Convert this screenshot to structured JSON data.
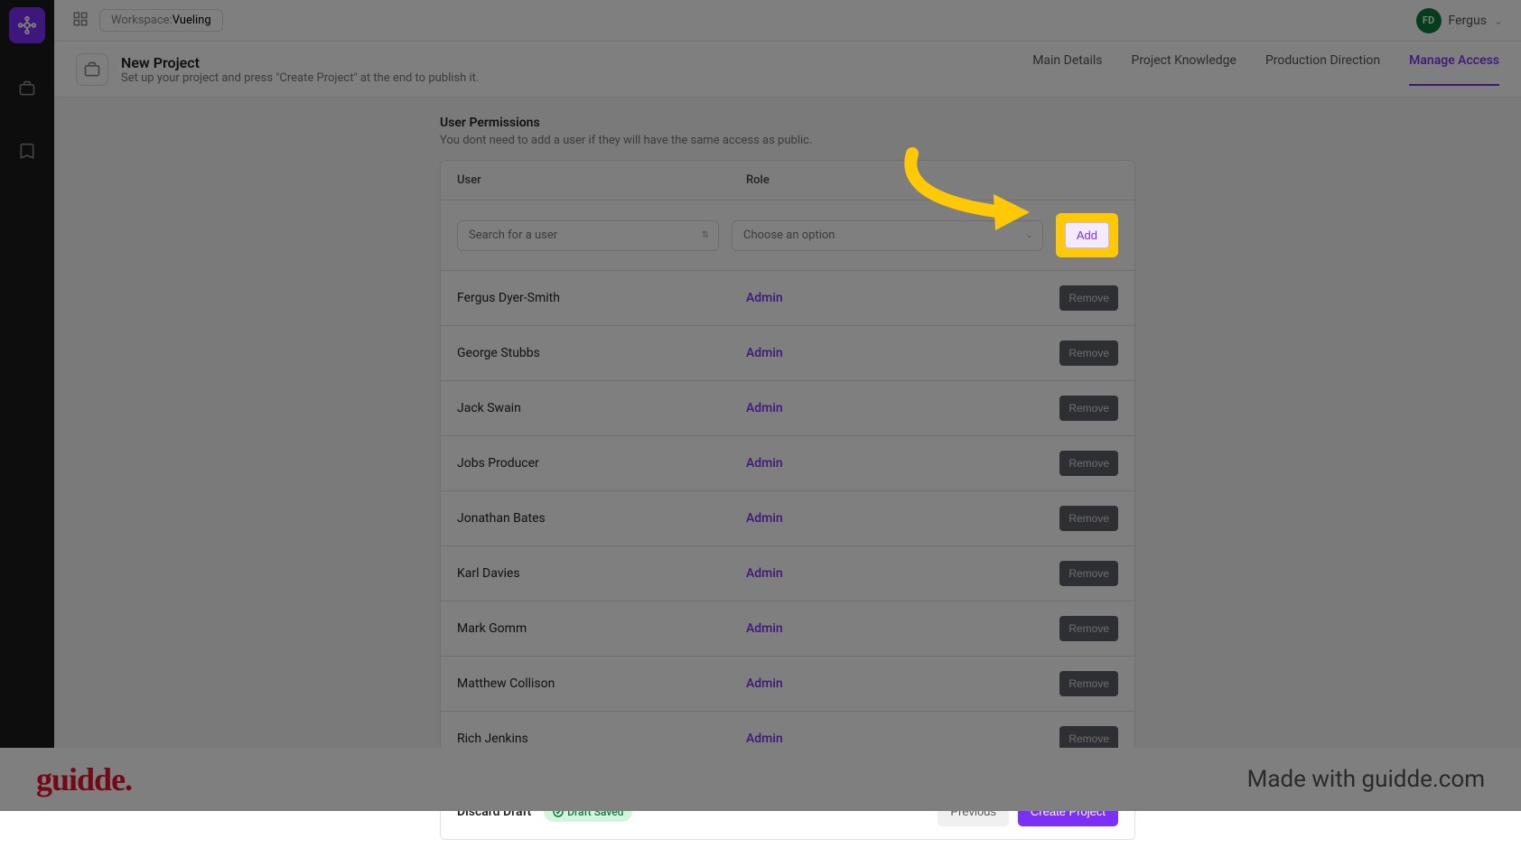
{
  "workspace": {
    "label": "Workspace:",
    "name": "Vueling"
  },
  "user": {
    "initials": "FD",
    "name": "Fergus"
  },
  "header": {
    "title": "New Project",
    "subtitle": "Set up your project and press \"Create Project\" at the end to publish it."
  },
  "tabs": [
    {
      "label": "Main Details",
      "active": false
    },
    {
      "label": "Project Knowledge",
      "active": false
    },
    {
      "label": "Production Direction",
      "active": false
    },
    {
      "label": "Manage Access",
      "active": true
    }
  ],
  "section": {
    "title": "User Permissions",
    "desc": "You dont need to add a user if they will have the same access as public."
  },
  "table": {
    "col_user": "User",
    "col_role": "Role",
    "search_placeholder": "Search for a user",
    "role_placeholder": "Choose an option",
    "add_label": "Add",
    "remove_label": "Remove",
    "rows": [
      {
        "name": "Fergus Dyer-Smith",
        "role": "Admin"
      },
      {
        "name": "George Stubbs",
        "role": "Admin"
      },
      {
        "name": "Jack Swain",
        "role": "Admin"
      },
      {
        "name": "Jobs Producer",
        "role": "Admin"
      },
      {
        "name": "Jonathan Bates",
        "role": "Admin"
      },
      {
        "name": "Karl Davies",
        "role": "Admin"
      },
      {
        "name": "Mark Gomm",
        "role": "Admin"
      },
      {
        "name": "Matthew Collison",
        "role": "Admin"
      },
      {
        "name": "Rich Jenkins",
        "role": "Admin"
      }
    ]
  },
  "footer": {
    "discard": "Discard Draft",
    "saved": "Draft Saved",
    "previous": "Previous",
    "create": "Create Project"
  },
  "guidde": {
    "logo": "guidde.",
    "made": "Made with guidde.com"
  }
}
